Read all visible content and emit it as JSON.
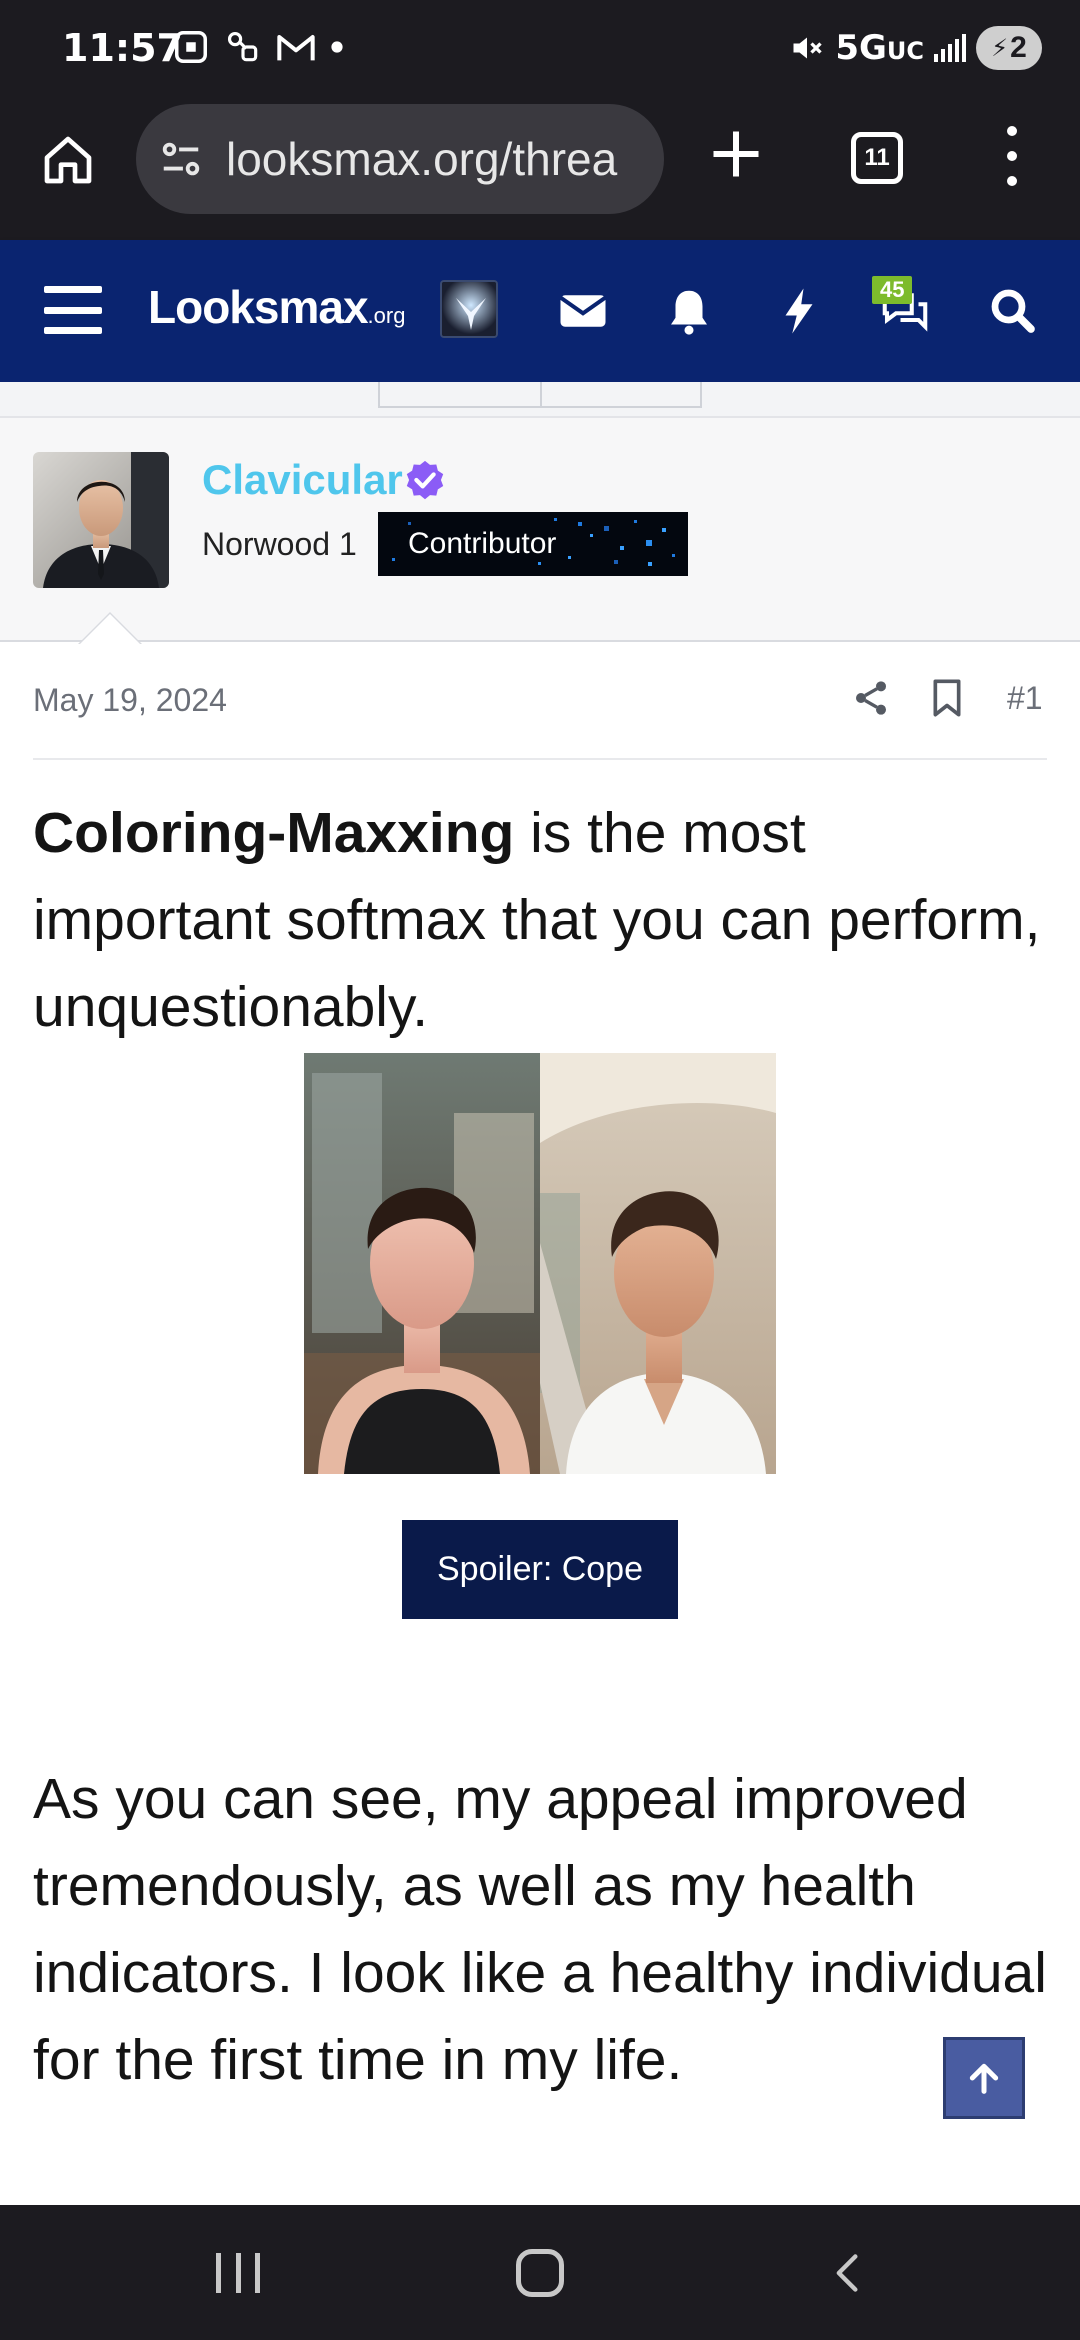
{
  "status_bar": {
    "time": "11:57",
    "network": "5G",
    "network_suffix": "UC",
    "battery": "2"
  },
  "browser": {
    "url": "looksmax.org/threa",
    "tab_count": "11"
  },
  "site_nav": {
    "logo_text": "Looksmax",
    "logo_suffix": ".org",
    "messages_badge": "45"
  },
  "post": {
    "username": "Clavicular",
    "user_title": "Norwood 1",
    "badge_label": "Contributor",
    "date": "May 19, 2024",
    "number": "#1",
    "intro_bold": "Coloring-Maxxing",
    "intro_rest": " is the most important softmax that you can perform, unquestionably.",
    "spoiler_label": "Spoiler: Cope",
    "paragraph_2": "As you can see, my appeal improved tremendously, as well as my health indicators. I look like a healthy individual for the first time in my life."
  },
  "colors": {
    "site_nav_bg": "#0a2470",
    "username": "#4fc6ec",
    "verified": "#8b5cf6",
    "spoiler_bg": "#0a1a4a",
    "messages_badge_bg": "#7dbb2c"
  }
}
